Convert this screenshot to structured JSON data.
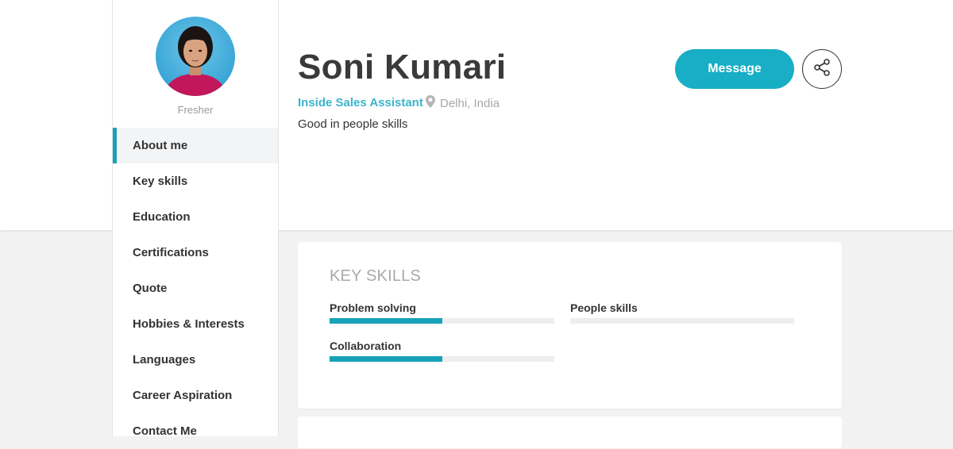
{
  "sidebar": {
    "status": "Fresher",
    "nav": [
      {
        "label": "About me",
        "active": true
      },
      {
        "label": "Key skills"
      },
      {
        "label": "Education"
      },
      {
        "label": "Certifications"
      },
      {
        "label": "Quote"
      },
      {
        "label": "Hobbies & Interests"
      },
      {
        "label": "Languages"
      },
      {
        "label": "Career Aspiration"
      },
      {
        "label": "Contact Me"
      }
    ]
  },
  "profile": {
    "name": "Soni Kumari",
    "job_title": "Inside Sales Assistant",
    "location": "Delhi, India",
    "bio": "Good in people skills",
    "location_icon": "map-pin-icon"
  },
  "actions": {
    "message_label": "Message",
    "share_icon": "share-icon"
  },
  "key_skills": {
    "title": "KEY SKILLS",
    "skills": [
      {
        "name": "Problem solving",
        "level": 0.5
      },
      {
        "name": "People skills",
        "level": 0
      },
      {
        "name": "Collaboration",
        "level": 0.5
      }
    ]
  },
  "colors": {
    "accent": "#17a2b8",
    "job_title": "#3bb4cb",
    "button": "#17aec6"
  }
}
